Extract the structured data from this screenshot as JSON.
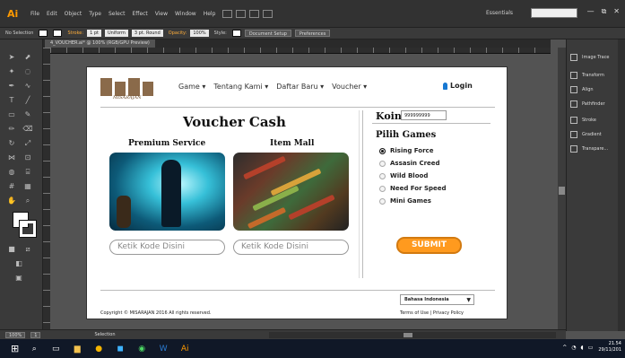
{
  "app": {
    "logo": "Ai",
    "menu": [
      "File",
      "Edit",
      "Object",
      "Type",
      "Select",
      "Effect",
      "View",
      "Window",
      "Help"
    ],
    "workspace": "Essentials",
    "window_controls": [
      "—",
      "⧉",
      "✕"
    ]
  },
  "control_bar": {
    "selection": "No Selection",
    "stroke_label": "Stroke:",
    "stroke_weight": "1 pt",
    "uniform": "Uniform",
    "brush": "3 pt. Round",
    "opacity_label": "Opacity:",
    "opacity_value": "100%",
    "style_label": "Style:",
    "document_setup": "Document Setup",
    "preferences": "Preferences"
  },
  "document": {
    "tab": "4_VOUCHER.ai* @ 100% (RGB/GPU Preview)"
  },
  "right_panel": {
    "items": [
      "Image Trace",
      "Transform",
      "Align",
      "Pathfinder",
      "Stroke",
      "Gradient",
      "Transpare..."
    ]
  },
  "status_bar": {
    "zoom": "100%",
    "artboard": "1",
    "mode": "Selection"
  },
  "taskbar": {
    "time": "21.54",
    "date": "29/11/201"
  },
  "site": {
    "logo_text": "MISARAJAN",
    "nav": [
      "Game ▾",
      "Tentang Kami ▾",
      "Daftar Baru ▾",
      "Voucher ▾"
    ],
    "login": "Login",
    "title": "Voucher Cash",
    "premium_label": "Premium Service",
    "itemmall_label": "Item Mall",
    "input1_placeholder": "Ketik Kode Disini",
    "input2_placeholder": "Ketik Kode Disini",
    "koin_label": "Koin",
    "koin_value": "999999999",
    "pilih_label": "Pilih Games",
    "games": [
      {
        "label": "Rising Force",
        "selected": true
      },
      {
        "label": "Assasin Creed",
        "selected": false
      },
      {
        "label": "Wild Blood",
        "selected": false
      },
      {
        "label": "Need For Speed",
        "selected": false
      },
      {
        "label": "Mini Games",
        "selected": false
      }
    ],
    "submit": "SUBMIT",
    "language": "Bahasa Indonesia",
    "copyright": "Copyright © MISARAJAN 2016 All rights reserved.",
    "terms": "Terms of Use | Privacy Policy"
  },
  "colors": {
    "accent_orange": "#ff9a1e",
    "login_blue": "#1778d2",
    "ai_orange": "#ff9a00"
  }
}
